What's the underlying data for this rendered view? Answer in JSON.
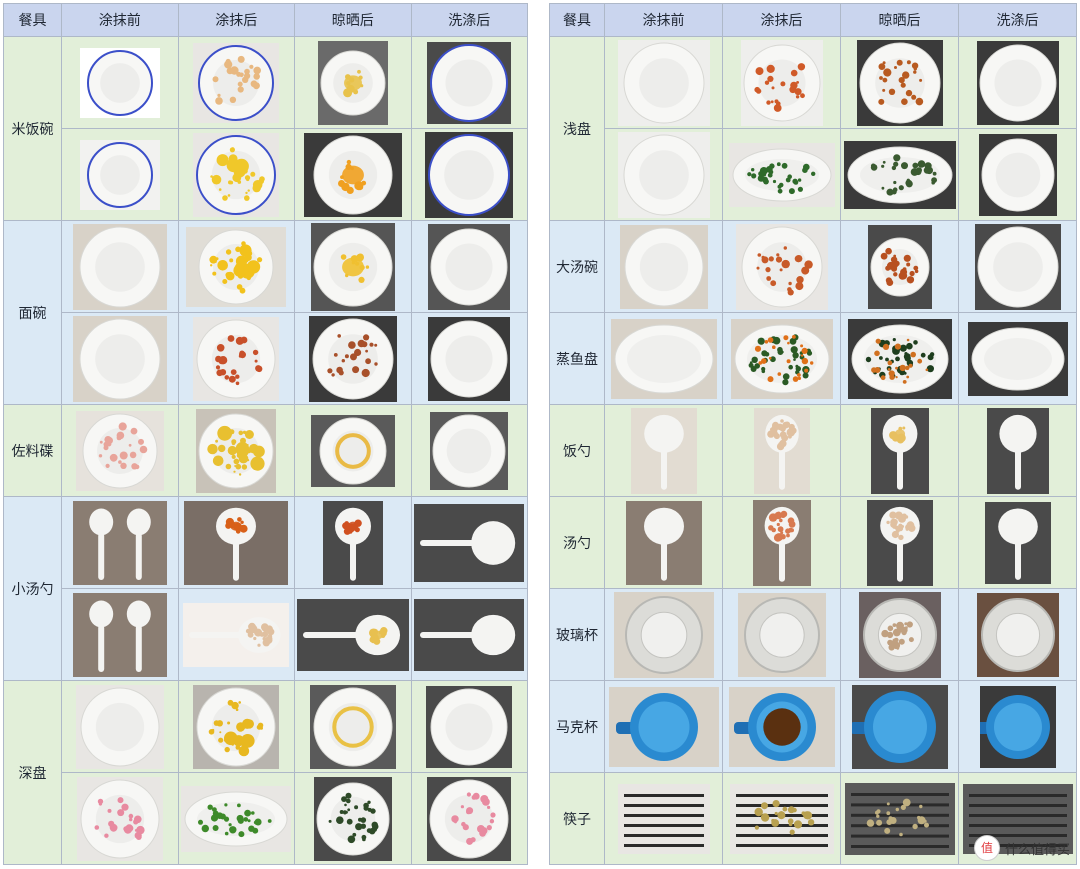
{
  "headers": [
    "餐具",
    "涂抹前",
    "涂抹后",
    "晾晒后",
    "洗涤后"
  ],
  "watermark": {
    "text": "什么值得买",
    "icon": "sign-value-icon"
  },
  "colors": {
    "header": "#cad5ee",
    "green_band": "#e2efd9",
    "blue_band": "#dbe9f5",
    "border": "#aeb8c8"
  },
  "left_groups": [
    {
      "label": "米饭碗",
      "band": "green",
      "rows": 2
    },
    {
      "label": "面碗",
      "band": "blue",
      "rows": 2
    },
    {
      "label": "佐料碟",
      "band": "green",
      "rows": 1
    },
    {
      "label": "小汤勺",
      "band": "blue",
      "rows": 2
    },
    {
      "label": "深盘",
      "band": "green",
      "rows": 2
    }
  ],
  "right_groups": [
    {
      "label": "浅盘",
      "band": "green",
      "rows": 2
    },
    {
      "label": "大汤碗",
      "band": "blue",
      "rows": 1
    },
    {
      "label": "蒸鱼盘",
      "band": "blue",
      "rows": 1
    },
    {
      "label": "饭勺",
      "band": "green",
      "rows": 1
    },
    {
      "label": "汤勺",
      "band": "green",
      "rows": 1
    },
    {
      "label": "玻璃杯",
      "band": "blue",
      "rows": 1
    },
    {
      "label": "马克杯",
      "band": "blue",
      "rows": 1
    },
    {
      "label": "筷子",
      "band": "green",
      "rows": 1
    }
  ],
  "photo_icons": {
    "rice_bowl": "rice-bowl-photo-icon",
    "noodle_bowl": "noodle-bowl-photo-icon",
    "sauce_dish": "sauce-dish-photo-icon",
    "small_spoon": "small-soup-spoon-photo-icon",
    "deep_plate": "deep-plate-photo-icon",
    "shallow_plate": "shallow-plate-photo-icon",
    "soup_bowl": "large-soup-bowl-photo-icon",
    "fish_plate": "fish-plate-photo-icon",
    "rice_ladle": "rice-ladle-photo-icon",
    "soup_ladle": "soup-ladle-photo-icon",
    "glass": "glass-cup-photo-icon",
    "mug": "mug-photo-icon",
    "chopsticks": "chopsticks-photo-icon"
  }
}
